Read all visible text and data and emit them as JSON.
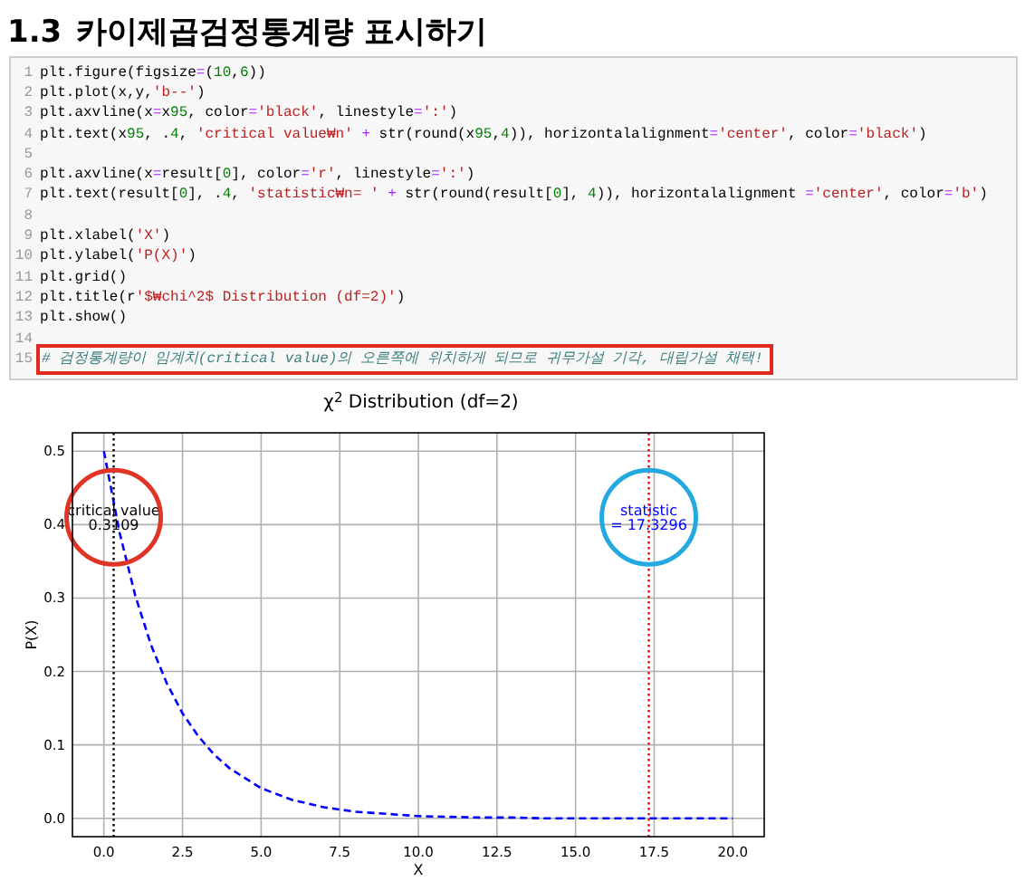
{
  "heading": {
    "number": "1.3",
    "title": "카이제곱검정통계량 표시하기"
  },
  "code_cell": {
    "lines": [
      {
        "number": "1",
        "text": "plt.figure(figsize=(10,6))",
        "kind": "code",
        "highlighted": false
      },
      {
        "number": "2",
        "text": "plt.plot(x,y,'b--')",
        "kind": "code",
        "highlighted": false
      },
      {
        "number": "3",
        "text": "plt.axvline(x=x95, color='black', linestyle=':')",
        "kind": "code",
        "highlighted": false
      },
      {
        "number": "4",
        "text": "plt.text(x95, .4, 'critical value₩n' + str(round(x95,4)), horizontalalignment='center', color='black')",
        "kind": "code",
        "highlighted": false
      },
      {
        "number": "5"
      },
      {
        "number": "6",
        "text": "plt.axvline(x=result[0], color='r', linestyle=':')",
        "kind": "code",
        "highlighted": false
      },
      {
        "number": "7",
        "text": "plt.text(result[0], .4, 'statistic₩n= ' + str(round(result[0], 4)), horizontalalignment ='center', color='b')",
        "kind": "code",
        "highlighted": false
      },
      {
        "number": "8"
      },
      {
        "number": "9",
        "text": "plt.xlabel('X')",
        "kind": "code",
        "highlighted": false
      },
      {
        "number": "10",
        "text": "plt.ylabel('P(X)')",
        "kind": "code",
        "highlighted": false
      },
      {
        "number": "11",
        "text": "plt.grid()",
        "kind": "code",
        "highlighted": false
      },
      {
        "number": "12",
        "text": "plt.title(r'$₩chi^2$ Distribution (df=2)')",
        "kind": "code",
        "highlighted": false
      },
      {
        "number": "13",
        "text": "plt.show()",
        "kind": "code",
        "highlighted": false
      },
      {
        "number": "14"
      },
      {
        "number": "15",
        "text": "# 검정통계량이 임계치(critical value)의 오른쪽에 위치하게 되므로 귀무가설 기각, 대립가설 채택!",
        "kind": "comment",
        "highlighted": true
      }
    ]
  },
  "output": {
    "chart_data": {
      "type": "line",
      "title": "χ$^{2}$ Distribution (df=2)",
      "xlabel": "X",
      "ylabel": "P(X)",
      "grid": true,
      "x": [
        0,
        0.5,
        1,
        1.5,
        2,
        2.5,
        3,
        3.5,
        4,
        5,
        6,
        7,
        8,
        9,
        10,
        11,
        12,
        13,
        14,
        15,
        16,
        17,
        18,
        19,
        20
      ],
      "series": [
        {
          "color": "#0000ff",
          "line_style": "dashed",
          "values": [
            0.5,
            0.389,
            0.303,
            0.236,
            0.184,
            0.143,
            0.112,
            0.087,
            0.068,
            0.041,
            0.025,
            0.015,
            0.009,
            0.006,
            0.003,
            0.002,
            0.001,
            0.001,
            0,
            0,
            0,
            0,
            0,
            0,
            0
          ]
        }
      ],
      "xlim": [
        -1,
        21
      ],
      "ylim": [
        -0.025,
        0.525
      ],
      "xticks": [
        {
          "value": 0,
          "label": "0.0"
        },
        {
          "value": 2.5,
          "label": "2.5"
        },
        {
          "value": 5,
          "label": "5.0"
        },
        {
          "value": 7.5,
          "label": "7.5"
        },
        {
          "value": 10,
          "label": "10.0"
        },
        {
          "value": 12.5,
          "label": "12.5"
        },
        {
          "value": 15,
          "label": "15.0"
        },
        {
          "value": 17.5,
          "label": "17.5"
        },
        {
          "value": 20,
          "label": "20.0"
        }
      ],
      "yticks": [
        {
          "value": 0,
          "label": "0.0"
        },
        {
          "value": 0.1,
          "label": "0.1"
        },
        {
          "value": 0.2,
          "label": "0.2"
        },
        {
          "value": 0.3,
          "label": "0.3"
        },
        {
          "value": 0.4,
          "label": "0.4"
        },
        {
          "value": 0.5,
          "label": "0.5"
        }
      ],
      "ref_lines": [
        {
          "axis": "x",
          "value": 0.3109,
          "color": "#000000"
        },
        {
          "axis": "x",
          "value": 17.3296,
          "color": "#ff0000"
        }
      ]
    },
    "callouts": [
      {
        "color": "#e03426",
        "labels": [
          {
            "text": "critical value",
            "color": "#000000"
          },
          {
            "text": "0.3109",
            "color": "#000000"
          }
        ]
      },
      {
        "color": "#23a8e0",
        "labels": [
          {
            "text": "statistic",
            "color": "#0000ff"
          },
          {
            "text": "= 17.3296",
            "color": "#0000ff"
          }
        ]
      }
    ]
  }
}
